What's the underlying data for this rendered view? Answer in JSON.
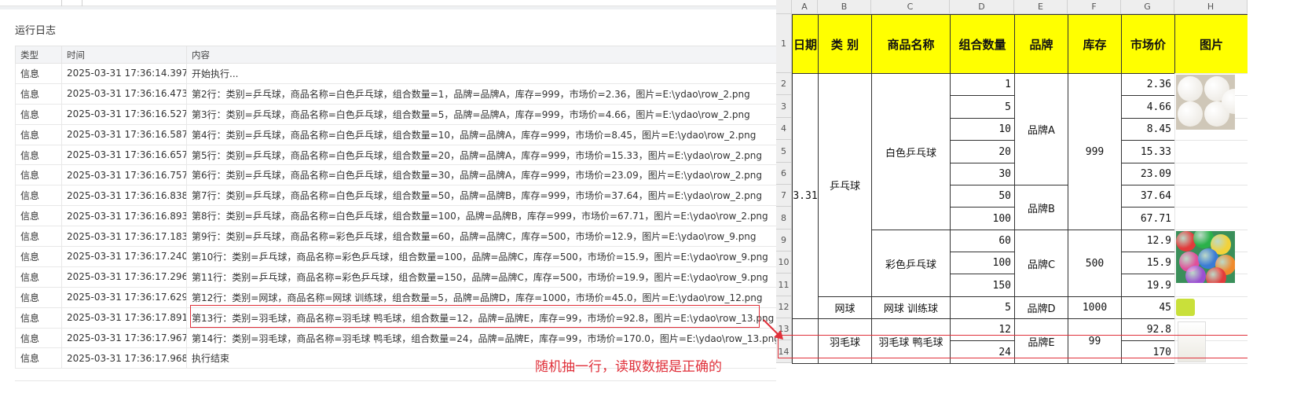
{
  "log": {
    "title": "运行日志",
    "columns": [
      "类型",
      "时间",
      "内容"
    ],
    "rows": [
      {
        "type": "信息",
        "time": "2025-03-31 17:36:14.397",
        "content": "开始执行..."
      },
      {
        "type": "信息",
        "time": "2025-03-31 17:36:16.473",
        "content": "第2行：类别=乒乓球，商品名称=白色乒乓球，组合数量=1，品牌=品牌A，库存=999，市场价=2.36，图片=E:\\ydao\\row_2.png"
      },
      {
        "type": "信息",
        "time": "2025-03-31 17:36:16.527",
        "content": "第3行：类别=乒乓球，商品名称=白色乒乓球，组合数量=5，品牌=品牌A，库存=999，市场价=4.66，图片=E:\\ydao\\row_2.png"
      },
      {
        "type": "信息",
        "time": "2025-03-31 17:36:16.587",
        "content": "第4行：类别=乒乓球，商品名称=白色乒乓球，组合数量=10，品牌=品牌A，库存=999，市场价=8.45，图片=E:\\ydao\\row_2.png"
      },
      {
        "type": "信息",
        "time": "2025-03-31 17:36:16.657",
        "content": "第5行：类别=乒乓球，商品名称=白色乒乓球，组合数量=20，品牌=品牌A，库存=999，市场价=15.33，图片=E:\\ydao\\row_2.png"
      },
      {
        "type": "信息",
        "time": "2025-03-31 17:36:16.757",
        "content": "第6行：类别=乒乓球，商品名称=白色乒乓球，组合数量=30，品牌=品牌A，库存=999，市场价=23.09，图片=E:\\ydao\\row_2.png"
      },
      {
        "type": "信息",
        "time": "2025-03-31 17:36:16.838",
        "content": "第7行：类别=乒乓球，商品名称=白色乒乓球，组合数量=50，品牌=品牌B，库存=999，市场价=37.64，图片=E:\\ydao\\row_2.png"
      },
      {
        "type": "信息",
        "time": "2025-03-31 17:36:16.893",
        "content": "第8行：类别=乒乓球，商品名称=白色乒乓球，组合数量=100，品牌=品牌B，库存=999，市场价=67.71，图片=E:\\ydao\\row_2.png"
      },
      {
        "type": "信息",
        "time": "2025-03-31 17:36:17.183",
        "content": "第9行：类别=乒乓球，商品名称=彩色乒乓球，组合数量=60，品牌=品牌C，库存=500，市场价=12.9，图片=E:\\ydao\\row_9.png"
      },
      {
        "type": "信息",
        "time": "2025-03-31 17:36:17.240",
        "content": "第10行：类别=乒乓球，商品名称=彩色乒乓球，组合数量=100，品牌=品牌C，库存=500，市场价=15.9，图片=E:\\ydao\\row_9.png"
      },
      {
        "type": "信息",
        "time": "2025-03-31 17:36:17.296",
        "content": "第11行：类别=乒乓球，商品名称=彩色乒乓球，组合数量=150，品牌=品牌C，库存=500，市场价=19.9，图片=E:\\ydao\\row_9.png"
      },
      {
        "type": "信息",
        "time": "2025-03-31 17:36:17.629",
        "content": "第12行：类别=网球，商品名称=网球 训练球，组合数量=5，品牌=品牌D，库存=1000，市场价=45.0，图片=E:\\ydao\\row_12.png"
      },
      {
        "type": "信息",
        "time": "2025-03-31 17:36:17.891",
        "content": "第13行：类别=羽毛球，商品名称=羽毛球 鸭毛球，组合数量=12，品牌=品牌E，库存=99，市场价=92.8，图片=E:\\ydao\\row_13.png"
      },
      {
        "type": "信息",
        "time": "2025-03-31 17:36:17.967",
        "content": "第14行：类别=羽毛球，商品名称=羽毛球 鸭毛球，组合数量=24，品牌=品牌E，库存=99，市场价=170.0，图片=E:\\ydao\\row_13.png"
      },
      {
        "type": "信息",
        "time": "2025-03-31 17:36:17.968",
        "content": "执行结束"
      }
    ]
  },
  "sheet": {
    "col_letters": [
      "A",
      "B",
      "C",
      "D",
      "E",
      "F",
      "G",
      "H"
    ],
    "row_numbers": [
      "1",
      "2",
      "3",
      "4",
      "5",
      "6",
      "7",
      "8",
      "9",
      "10",
      "11",
      "12",
      "13",
      "14"
    ],
    "headers": [
      "日期",
      "类 别",
      "商品名称",
      "组合数量",
      "品牌",
      "库存",
      "市场价",
      "图片"
    ],
    "date": "3.31",
    "categories": {
      "pingpong": "乒乓球",
      "tennis": "网球",
      "badminton": "羽毛球"
    },
    "products": {
      "white": "白色乒乓球",
      "color": "彩色乒乓球",
      "tennis": "网球 训练球",
      "badminton": "羽毛球 鸭毛球"
    },
    "quantities": [
      "1",
      "5",
      "10",
      "20",
      "30",
      "50",
      "100",
      "60",
      "100",
      "150",
      "5",
      "12",
      "24"
    ],
    "brands": {
      "A": "品牌A",
      "B": "品牌B",
      "C": "品牌C",
      "D": "品牌D",
      "E": "品牌E"
    },
    "stocks": {
      "white": "999",
      "color": "500",
      "tennis": "1000",
      "badminton": "99"
    },
    "prices": [
      "2.36",
      "4.66",
      "8.45",
      "15.33",
      "23.09",
      "37.64",
      "67.71",
      "12.9",
      "15.9",
      "19.9",
      "45",
      "92.8",
      "170"
    ],
    "header_color": "#ffff00"
  },
  "annotation": {
    "note": "随机抽一行，读取数据是正确的",
    "color": "#e0303a"
  }
}
